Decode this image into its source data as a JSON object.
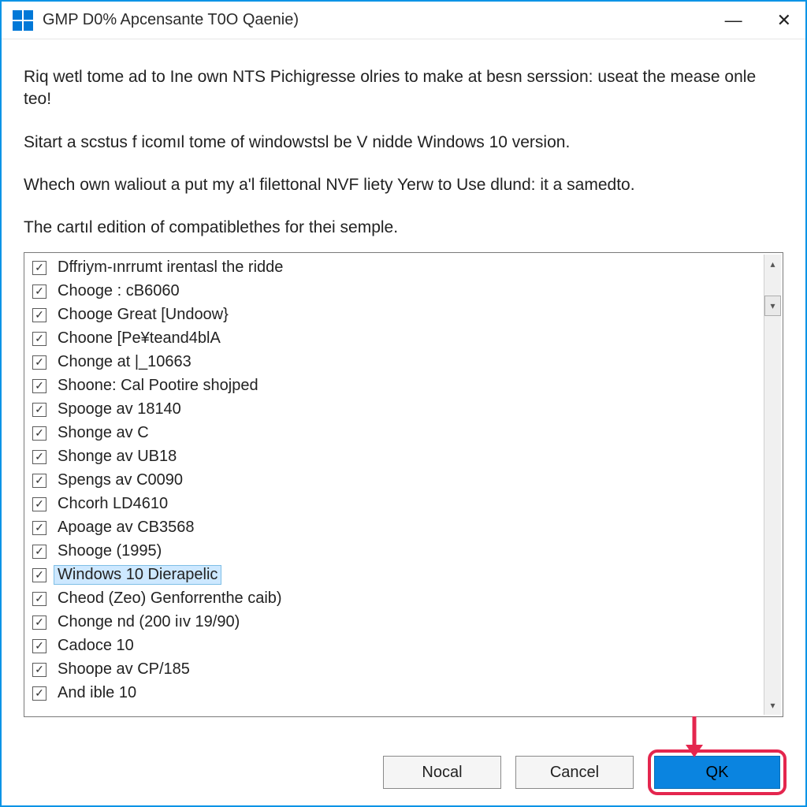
{
  "titlebar": {
    "title": "GMP D0% Apcensante T0O Qaenie)"
  },
  "paragraphs": {
    "p1": "Riq wetl tome ad to Ine own NTS Pichigresse olries to make at besn serssion: useat the mease onle teo!",
    "p2": "Sitart a scstus f icomıl tome of windowstsl be V nidde Windows 10 version.",
    "p3": "Whech own waliout a put my a'l filettonal NVF liety Yerw to Use dlund: it a samedto.",
    "p4": "The cartıl edition of compatiblethes for thei semple."
  },
  "list": [
    {
      "label": "Dffriym-ınrrumt irentasl the ridde",
      "checked": true,
      "selected": false
    },
    {
      "label": "Chooge : cB6060",
      "checked": true,
      "selected": false
    },
    {
      "label": "Chooge Great [Undoow}",
      "checked": true,
      "selected": false
    },
    {
      "label": "Choone [Pe¥teand4blA",
      "checked": true,
      "selected": false
    },
    {
      "label": "Chonge at |_10663",
      "checked": true,
      "selected": false
    },
    {
      "label": "Shoone: Cal Pootire shojped",
      "checked": true,
      "selected": false
    },
    {
      "label": "Spooge av 18140",
      "checked": true,
      "selected": false
    },
    {
      "label": "Shonge av C",
      "checked": true,
      "selected": false
    },
    {
      "label": "Shonge av UB18",
      "checked": true,
      "selected": false
    },
    {
      "label": "Spengs av C0090",
      "checked": true,
      "selected": false
    },
    {
      "label": "Chcorh LD4610",
      "checked": true,
      "selected": false
    },
    {
      "label": "Apoage av CB3568",
      "checked": true,
      "selected": false
    },
    {
      "label": "Shooge (1995)",
      "checked": true,
      "selected": false
    },
    {
      "label": "Windows 10 Dierapelic",
      "checked": true,
      "selected": true
    },
    {
      "label": "Cheod (Zeo) Genforrenthe caib)",
      "checked": true,
      "selected": false
    },
    {
      "label": "Chonge nd (200 iıv 19/90)",
      "checked": true,
      "selected": false
    },
    {
      "label": "Cadoce 10",
      "checked": true,
      "selected": false
    },
    {
      "label": "Shoope av CP/185",
      "checked": true,
      "selected": false
    },
    {
      "label": "And ible 10",
      "checked": true,
      "selected": false
    }
  ],
  "buttons": {
    "nocal": "Nocal",
    "cancel": "Cancel",
    "ok": "QK"
  },
  "colors": {
    "accent": "#0a84e0",
    "highlight": "#e4264e",
    "selection": "#cde8ff"
  }
}
